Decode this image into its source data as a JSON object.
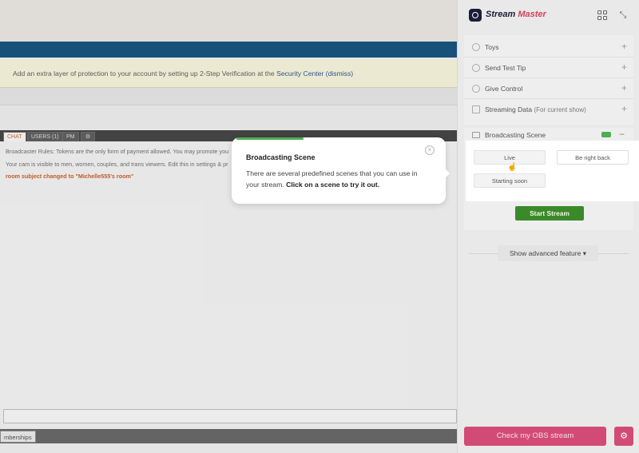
{
  "alert": {
    "text_before": "Add an extra layer of protection to your account by setting up 2-Step Verification at the",
    "link": "Security Center",
    "dismiss": "(dismiss)"
  },
  "chat_tabs": [
    "CHAT",
    "USERS (1)",
    "PM"
  ],
  "chat_lines": {
    "rules": "Broadcaster Rules: Tokens are the only form of payment allowed. You may promote you",
    "cam": "Your cam is visible to men, women, couples, and trans viewers. Edit this in settings & pr",
    "subject": "room subject changed to \"Michelle555's room\""
  },
  "footer_tab": "mberships",
  "popover": {
    "title": "Broadcasting Scene",
    "text": "There are several predefined scenes that you can use in your stream.",
    "bold_text": "Click on a scene to try it out.",
    "close": "×"
  },
  "panel": {
    "logo_main": "Stream",
    "logo_accent": "Master",
    "menu": [
      {
        "label": "Toys",
        "sub": ""
      },
      {
        "label": "Send Test Tip",
        "sub": ""
      },
      {
        "label": "Give Control",
        "sub": ""
      },
      {
        "label": "Streaming Data",
        "sub": "(For current show)"
      }
    ],
    "scene_label": "Broadcasting Scene",
    "scenes": [
      "Live",
      "Be right back",
      "Starting soon"
    ],
    "start_stream": "Start Stream",
    "advanced": "Show advanced feature ▾",
    "obs_button": "Check my OBS stream"
  },
  "colors": {
    "accent_pink": "#d24b76",
    "start_green": "#3a8a2a",
    "progress_green": "#4caf50",
    "alert_bg": "#f6f3da",
    "nav_blue": "#0a4a78"
  },
  "icons": [
    "logo-icon",
    "grid-icon",
    "collapse-icon",
    "toys-icon",
    "tip-icon",
    "control-icon",
    "chart-icon",
    "scene-icon",
    "close-icon",
    "gear-icon",
    "cursor-icon"
  ]
}
